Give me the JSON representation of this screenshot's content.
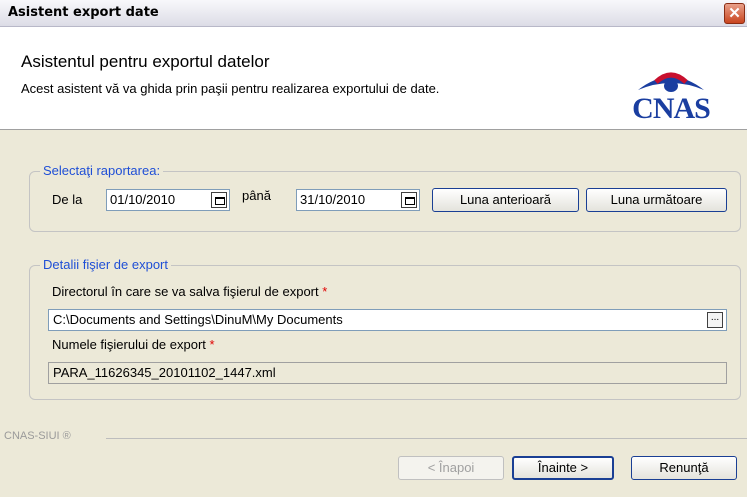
{
  "window": {
    "title": "Asistent export date",
    "close_label": "✕"
  },
  "header": {
    "title": "Asistentul pentru exportul datelor",
    "subtitle": "Acest asistent vă va ghida prin paşii pentru realizarea exportului de date.",
    "logo_text": "CNAS"
  },
  "report_group": {
    "label": "Selectaţi raportarea:",
    "from_label": "De la",
    "from_value": "01/10/2010",
    "to_label": "până",
    "to_value": "31/10/2010",
    "prev_month_label": "Luna anterioară",
    "next_month_label": "Luna următoare"
  },
  "export_group": {
    "label": "Detalii fişier de export",
    "directory_label": "Directorul în care se va salva fişierul de export",
    "directory_value": "C:\\Documents and Settings\\DinuM\\My Documents",
    "browse_label": "...",
    "filename_label": "Numele fişierului de export",
    "filename_value": "PARA_11626345_20101102_1447.xml",
    "required_marker": "*"
  },
  "footer": {
    "brand": "CNAS-SIUI ®",
    "back_label": "< Înapoi",
    "next_label": "Înainte >",
    "cancel_label": "Renunţă"
  }
}
